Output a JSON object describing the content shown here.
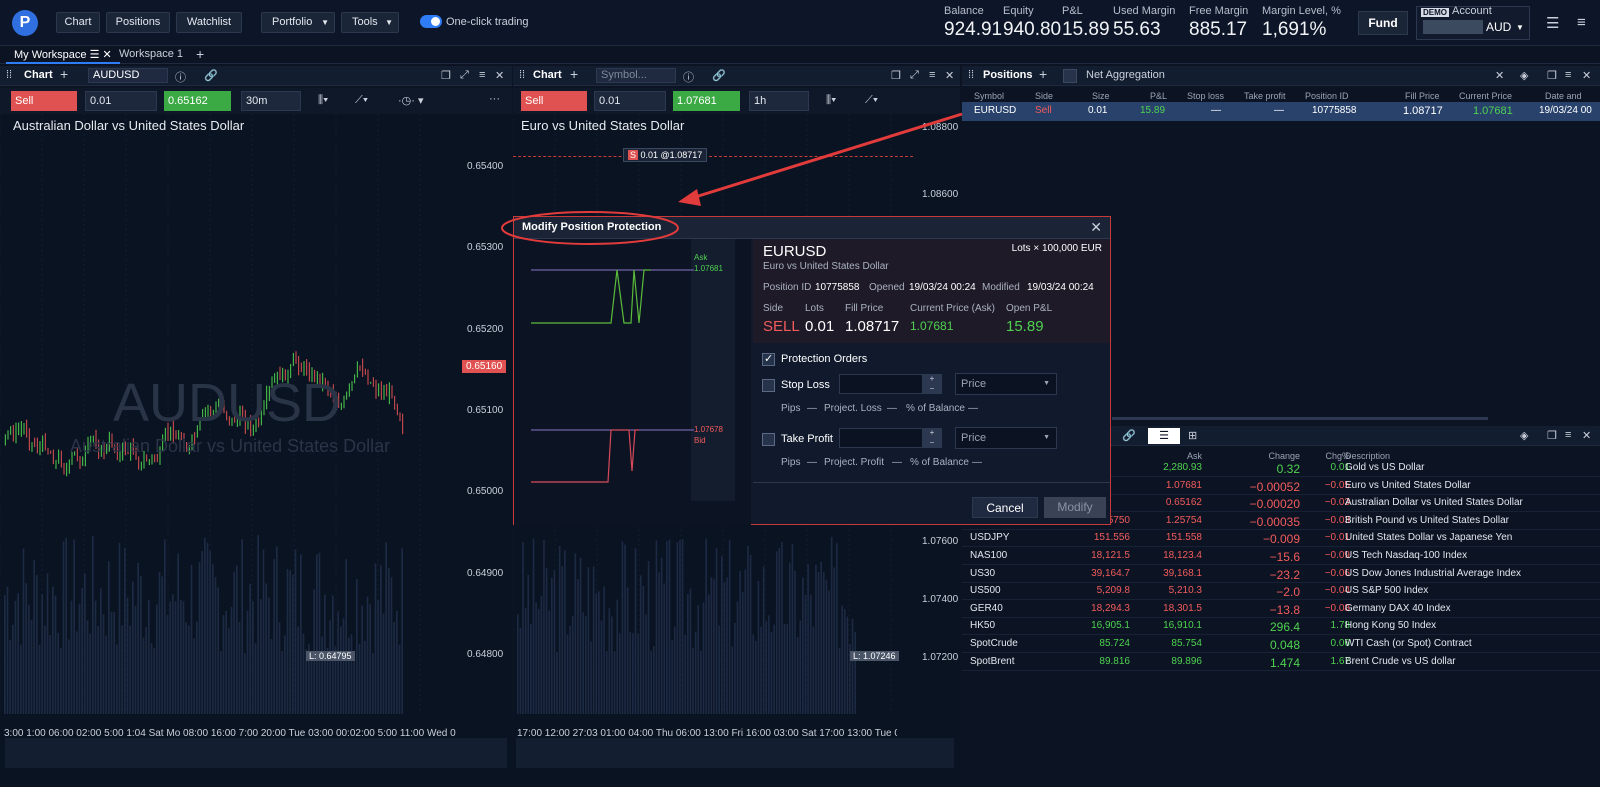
{
  "nav": {
    "chart": "Chart",
    "positions": "Positions",
    "watchlist": "Watchlist",
    "portfolio": "Portfolio",
    "tools": "Tools",
    "one_click": "One-click trading"
  },
  "metrics": [
    {
      "label": "Balance",
      "value": "924.91"
    },
    {
      "label": "Equity",
      "value": "940.80"
    },
    {
      "label": "P&L",
      "value": "15.89"
    },
    {
      "label": "Used Margin",
      "value": "55.63"
    },
    {
      "label": "Free Margin",
      "value": "885.17"
    },
    {
      "label": "Margin Level, %",
      "value": "1,691%"
    }
  ],
  "account": {
    "fund": "Fund",
    "demo": "DEMO",
    "label": "Account",
    "currency": "AUD"
  },
  "workspaces": [
    "My Workspace",
    "Workspace 1"
  ],
  "chart1": {
    "title": "Chart",
    "symbol": "AUDUSD",
    "sell": "Sell 0.65160",
    "qty": "0.01",
    "buy": "0.65162 Buy",
    "tf": "30m",
    "pair_name": "Australian Dollar vs United States Dollar",
    "wm_symbol": "AUDUSD",
    "wm_name": "Australian Dollar vs United States Dollar",
    "prices": [
      "0.65400",
      "0.65300",
      "0.65200",
      "0.65100",
      "0.65000",
      "0.64900",
      "0.64800"
    ],
    "current": "0.65160",
    "low": "L: 0.64795",
    "time_axis": "3:00 1:00 06:00 02:00 5:00 1:04 Sat Mo 08:00 16:00 7:00 20:00 Tue 03:00 00:02:00 5:00 11:00 Wed 06:00 09:00"
  },
  "chart2": {
    "title": "Chart",
    "symbol_placeholder": "Symbol...",
    "sell": "Sell 1.07678",
    "qty": "0.01",
    "buy": "1.07681 Buy",
    "tf": "1h",
    "pair_name": "Euro vs United States Dollar",
    "prices": [
      "1.08600",
      "1.07600",
      "1.07400",
      "1.07200"
    ],
    "top_price": "1.08800",
    "pos_line": "0.01 @1.08717",
    "pos_tag": "S",
    "low": "L: 1.07246",
    "time_axis": "17:00 12:00 27:03 01:00 04:00 Thu 06:00 13:00 Fri 16:00 03:00 Sat 17:00 13:00 Tue 06:00 03:00 Wed 05:00"
  },
  "positions": {
    "title": "Positions",
    "net_agg": "Net Aggregation",
    "headers": [
      "Symbol",
      "Side",
      "Size",
      "P&L",
      "Stop loss",
      "Take profit",
      "Position ID",
      "Fill Price",
      "Current Price",
      "Date and Time"
    ],
    "row": {
      "symbol": "EURUSD",
      "side": "Sell",
      "size": "0.01",
      "pnl": "15.89",
      "sl": "—",
      "tp": "—",
      "id": "10775858",
      "fill": "1.08717",
      "current": "1.07681",
      "date": "19/03/24 00"
    }
  },
  "watchlist": {
    "headers": [
      "Ask",
      "Change",
      "Chg%",
      "Description"
    ],
    "rows": [
      {
        "sym": "",
        "bid": "",
        "ask": "2,280.93",
        "chg": "0.32",
        "pct": "0.01",
        "desc": "Gold vs US Dollar",
        "dir": "up"
      },
      {
        "sym": "",
        "bid": "",
        "ask": "1.07681",
        "chg": "−0.00052",
        "pct": "−0.05",
        "desc": "Euro vs United States Dollar",
        "dir": "down"
      },
      {
        "sym": "",
        "bid": "",
        "ask": "0.65162",
        "chg": "−0.00020",
        "pct": "−0.03",
        "desc": "Australian Dollar vs United States Dollar",
        "dir": "down"
      },
      {
        "sym": "GBPUSD",
        "bid": "1.25750",
        "ask": "1.25754",
        "chg": "−0.00035",
        "pct": "−0.03",
        "desc": "British Pound vs United States Dollar",
        "dir": "down"
      },
      {
        "sym": "USDJPY",
        "bid": "151.556",
        "ask": "151.558",
        "chg": "−0.009",
        "pct": "−0.01",
        "desc": "United States Dollar vs Japanese Yen",
        "dir": "down"
      },
      {
        "sym": "NAS100",
        "bid": "18,121.5",
        "ask": "18,123.4",
        "chg": "−15.6",
        "pct": "−0.09",
        "desc": "US Tech Nasdaq-100 Index",
        "dir": "down"
      },
      {
        "sym": "US30",
        "bid": "39,164.7",
        "ask": "39,168.1",
        "chg": "−23.2",
        "pct": "−0.06",
        "desc": "US Dow Jones Industrial Average Index",
        "dir": "down"
      },
      {
        "sym": "US500",
        "bid": "5,209.8",
        "ask": "5,210.3",
        "chg": "−2.0",
        "pct": "−0.04",
        "desc": "US S&P 500 Index",
        "dir": "down"
      },
      {
        "sym": "GER40",
        "bid": "18,294.3",
        "ask": "18,301.5",
        "chg": "−13.8",
        "pct": "−0.08",
        "desc": "Germany DAX 40 Index",
        "dir": "down"
      },
      {
        "sym": "HK50",
        "bid": "16,905.1",
        "ask": "16,910.1",
        "chg": "296.4",
        "pct": "1.78",
        "desc": "Hong Kong 50 Index",
        "dir": "up"
      },
      {
        "sym": "SpotCrude",
        "bid": "85.724",
        "ask": "85.754",
        "chg": "0.048",
        "pct": "0.06",
        "desc": "WTI Cash (or Spot) Contract",
        "dir": "up"
      },
      {
        "sym": "SpotBrent",
        "bid": "89.816",
        "ask": "89.896",
        "chg": "1.474",
        "pct": "1.67",
        "desc": "Brent Crude vs US dollar",
        "dir": "up"
      }
    ]
  },
  "modal": {
    "title": "Modify Position Protection",
    "symbol": "EURUSD",
    "name": "Euro vs United States Dollar",
    "lots": "Lots × 100,000 EUR",
    "pos_id_label": "Position ID",
    "pos_id": "10775858",
    "opened_label": "Opened",
    "opened": "19/03/24 00:24",
    "modified_label": "Modified",
    "modified": "19/03/24 00:24",
    "side_label": "Side",
    "side": "SELL",
    "lots_label": "Lots",
    "lots_val": "0.01",
    "fill_label": "Fill Price",
    "fill": "1.08717",
    "cur_label": "Current Price (Ask)",
    "cur": "1.07681",
    "pnl_label": "Open P&L",
    "pnl": "15.89",
    "protection": "Protection Orders",
    "stop_loss": "Stop Loss",
    "take_profit": "Take Profit",
    "price": "Price",
    "pips": "Pips",
    "dash": "—",
    "proj_loss": "Project. Loss",
    "proj_profit": "Project. Profit",
    "pct_balance": "% of Balance",
    "ask_label": "Ask",
    "ask_val": "1.07681",
    "bid_label": "Bid",
    "bid_val": "1.07678",
    "cancel": "Cancel",
    "modify": "Modify"
  },
  "colors": {
    "sell": "#e05252",
    "buy": "#3ba944",
    "accent": "#2f7df6",
    "annotation": "#e23b3b"
  }
}
